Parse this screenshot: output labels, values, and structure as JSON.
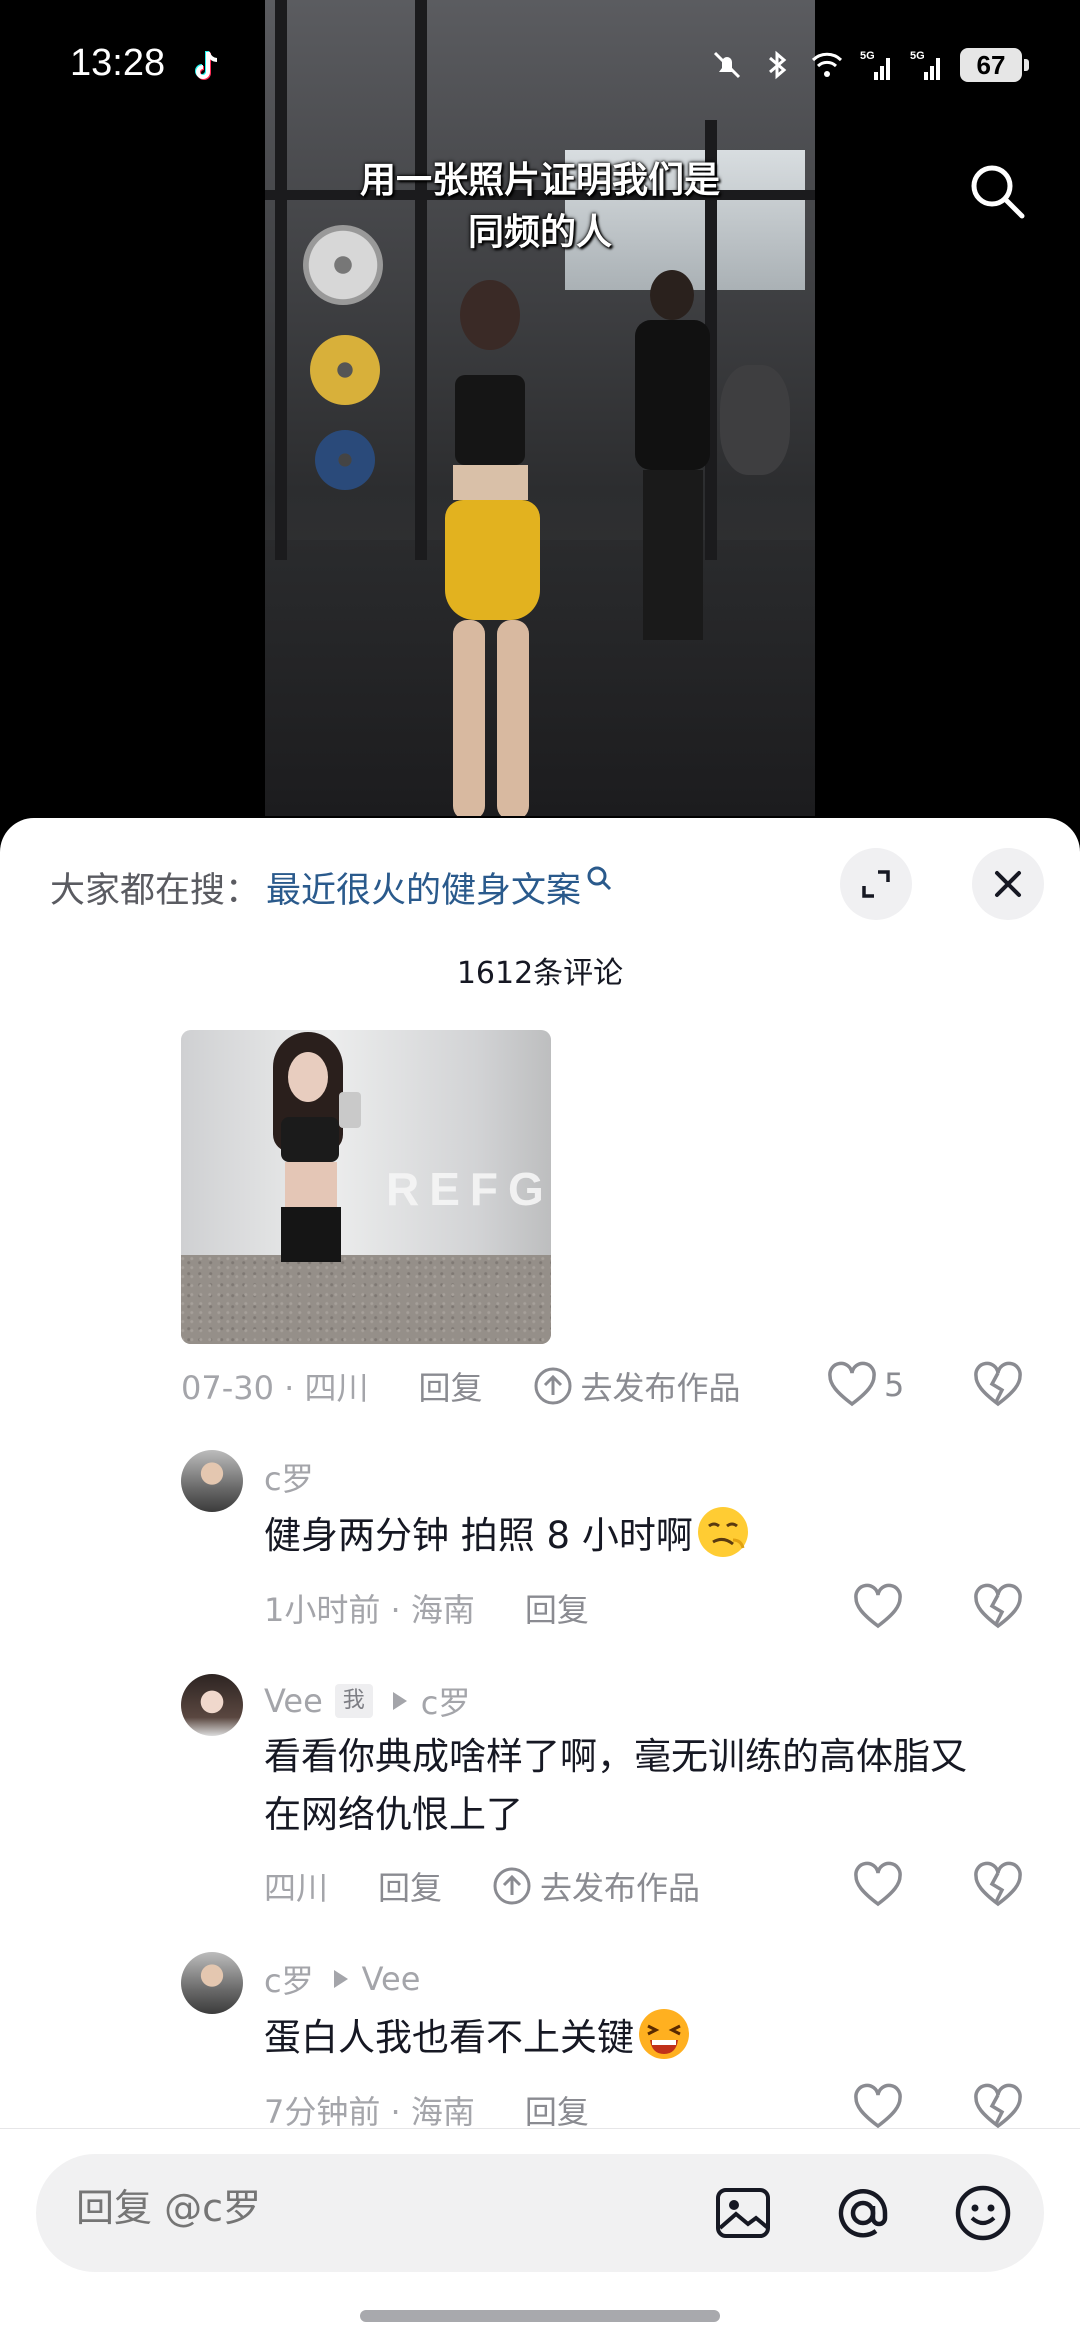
{
  "status_bar": {
    "time": "13:28",
    "battery": "67",
    "network_a": "5G",
    "network_b": "5G"
  },
  "video": {
    "caption_line1": "用一张照片证明我们是",
    "caption_line2": "同频的人"
  },
  "comments_panel": {
    "suggest_label": "大家都在搜：",
    "suggest_term": "最近很火的健身文案",
    "count_label": "1612条评论"
  },
  "photo_reply": {
    "photo_text": "REFG",
    "date": "07-30 · 四川",
    "reply_label": "回复",
    "publish_label": "去发布作品",
    "likes": "5"
  },
  "comments": [
    {
      "author": "c罗",
      "text": "健身两分钟 拍照 8 小时啊",
      "emoji": "smirk-emoji",
      "meta": "1小时前 · 海南",
      "reply_label": "回复"
    },
    {
      "author": "Vee",
      "me_tag": "我",
      "reply_to": "c罗",
      "text_line1": "看看你典成啥样了啊，毫无训练的高体脂又",
      "text_line2": "在网络仇恨上了",
      "meta": "四川",
      "reply_label": "回复",
      "publish_label": "去发布作品"
    },
    {
      "author": "c罗",
      "reply_to": "Vee",
      "text": "蛋白人我也看不上关键",
      "emoji": "laughing-emoji",
      "meta": "7分钟前 · 海南",
      "reply_label": "回复"
    }
  ],
  "composer": {
    "placeholder": "回复 @c罗"
  },
  "colors": {
    "accent_link": "#2a5a8c",
    "muted_text": "#a4a5aa",
    "sheet_bg": "#ffffff"
  }
}
